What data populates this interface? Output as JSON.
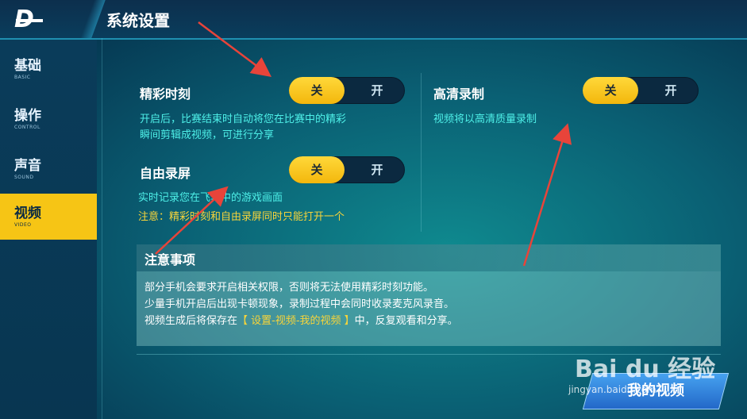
{
  "header": {
    "logo": "D",
    "title": "系统设置"
  },
  "sidebar": {
    "items": [
      {
        "label": "基础",
        "sub": "BASIC",
        "active": false
      },
      {
        "label": "操作",
        "sub": "CONTROL",
        "active": false
      },
      {
        "label": "声音",
        "sub": "SOUND",
        "active": false
      },
      {
        "label": "视频",
        "sub": "VIDEO",
        "active": true
      }
    ]
  },
  "settings": {
    "highlight": {
      "label": "精彩时刻",
      "off": "关",
      "on": "开",
      "desc_line1": "开启后，比赛结束时自动将您在比赛中的精彩",
      "desc_line2": "瞬间剪辑成视频，可进行分享"
    },
    "free_record": {
      "label": "自由录屏",
      "off": "关",
      "on": "开",
      "desc": "实时记录您在飞车中的游戏画面",
      "note": "注意：精彩时刻和自由录屏同时只能打开一个"
    },
    "hd_record": {
      "label": "高清录制",
      "off": "关",
      "on": "开",
      "desc": "视频将以高清质量录制"
    }
  },
  "notice": {
    "title": "注意事项",
    "line1": "部分手机会要求开启相关权限，否则将无法使用精彩时刻功能。",
    "line2": "少量手机开启后出现卡顿现象，录制过程中会同时收录麦克风录音。",
    "line3_pre": "视频生成后将保存在",
    "line3_hl": "【 设置-视频-我的视频 】",
    "line3_post": "中，反复观看和分享。"
  },
  "my_video_button": "我的视频",
  "watermark": {
    "main": "Bai du 经验",
    "sub": "jingyan.baidu.com"
  },
  "colors": {
    "accent": "#f6c515",
    "desc": "#4ef0e8",
    "note": "#f7d43a",
    "annotation": "#e8443a"
  }
}
